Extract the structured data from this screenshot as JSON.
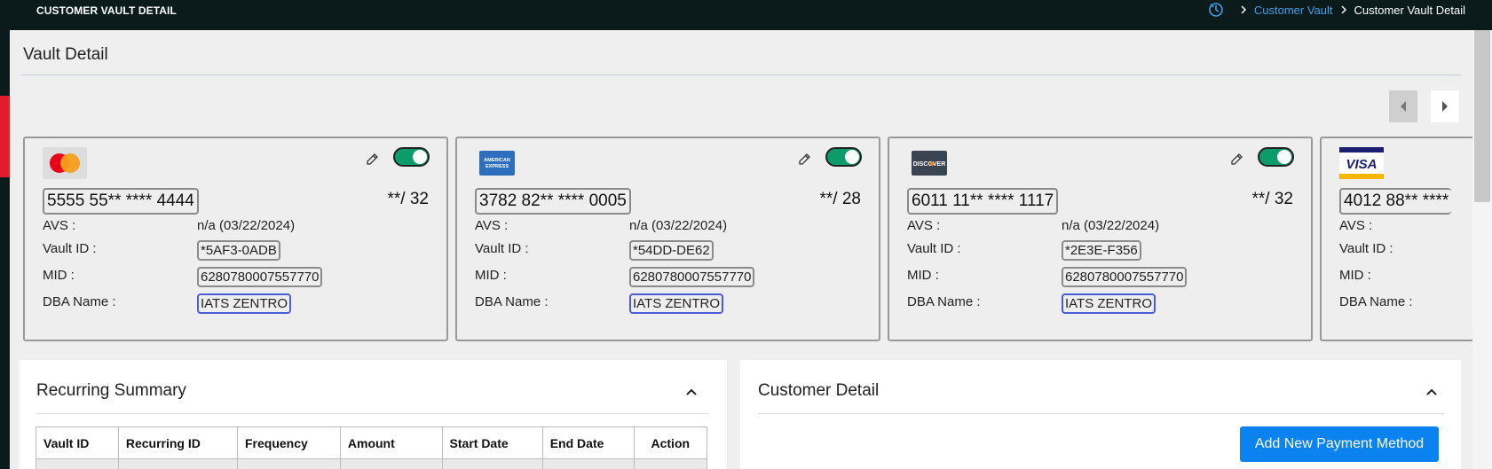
{
  "header": {
    "title": "CUSTOMER VAULT DETAIL",
    "breadcrumb": [
      "Customer Vault",
      "Customer Vault Detail"
    ]
  },
  "page": {
    "title": "Vault Detail"
  },
  "cards": [
    {
      "brand": "Mastercard",
      "number": "5555 55** **** 4444",
      "expiry": "**/ 32",
      "avs_label": "AVS :",
      "avs_value": "n/a (03/22/2024)",
      "vault_id_label": "Vault ID :",
      "vault_id": "*5AF3-0ADB",
      "mid_label": "MID :",
      "mid": "6280780007557770",
      "dba_label": "DBA Name :",
      "dba": "IATS ZENTRO",
      "enabled": true
    },
    {
      "brand": "American Express",
      "number": "3782 82** **** 0005",
      "expiry": "**/ 28",
      "avs_label": "AVS :",
      "avs_value": "n/a (03/22/2024)",
      "vault_id_label": "Vault ID :",
      "vault_id": "*54DD-DE62",
      "mid_label": "MID :",
      "mid": "6280780007557770",
      "dba_label": "DBA Name :",
      "dba": "IATS ZENTRO",
      "enabled": true
    },
    {
      "brand": "Discover",
      "number": "6011 11** **** 1117",
      "expiry": "**/ 32",
      "avs_label": "AVS :",
      "avs_value": "n/a (03/22/2024)",
      "vault_id_label": "Vault ID :",
      "vault_id": "*2E3E-F356",
      "mid_label": "MID :",
      "mid": "6280780007557770",
      "dba_label": "DBA Name :",
      "dba": "IATS ZENTRO",
      "enabled": true
    },
    {
      "brand": "Visa",
      "number": "4012 88** ****",
      "avs_label": "AVS :",
      "vault_id_label": "Vault ID :",
      "mid_label": "MID :",
      "dba_label": "DBA Name :"
    }
  ],
  "brand_logos": {
    "amex": "AMERICAN EXPRESS",
    "discover": "DISCOVER",
    "visa": "VISA"
  },
  "recurring": {
    "title": "Recurring Summary",
    "columns": [
      "Vault ID",
      "Recurring ID",
      "Frequency",
      "Amount",
      "Start Date",
      "End Date",
      "Action"
    ]
  },
  "customer": {
    "title": "Customer Detail",
    "add_button": "Add New Payment Method"
  },
  "colors": {
    "accent": "#0a82f0",
    "toggle_on": "#0e9b6a",
    "header_bg": "#0b1a1a",
    "link": "#3ea0e8"
  }
}
